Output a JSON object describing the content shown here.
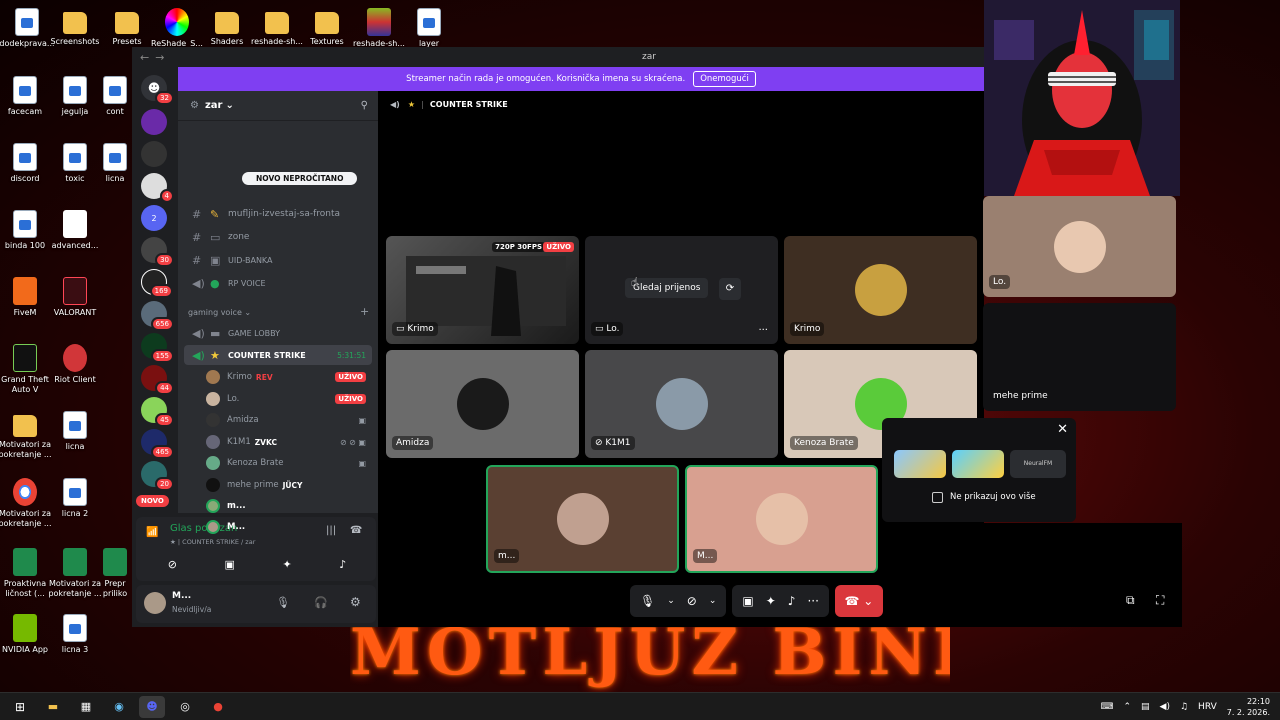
{
  "desktop": {
    "icons": [
      "dodekprava...",
      "Screenshots",
      "Presets",
      "ReShade_S...",
      "Shaders",
      "reshade-sh...",
      "Textures",
      "reshade-sh...",
      "layer",
      "facecam",
      "jegulja",
      "cont",
      "discord",
      "toxic",
      "licna",
      "binda 100",
      "advanced...",
      "FiveM",
      "VALORANT",
      "Grand Theft Auto V",
      "Riot Client",
      "Motivatori za pokretanje ...",
      "licna",
      "Motivatori za pokretanje ...",
      "licna 2",
      "Proaktivna ličnost (...",
      "Motivatori za pokretanje ...",
      "Prepr priliko",
      "NVIDIA App",
      "licna 3"
    ],
    "banner_text": "MOTLJUZ BINDA"
  },
  "taskbar": {
    "tray_language": "HRV",
    "time": "22:10",
    "date": "7. 2. 2026."
  },
  "window": {
    "title": "zar"
  },
  "notice": {
    "text": "Streamer način rada je omogućen. Korisnička imena su skraćena.",
    "button": "Onemogući"
  },
  "rail": {
    "badges": [
      "32",
      "4",
      "2",
      "30",
      "169",
      "656",
      "155",
      "44",
      "45",
      "465",
      "20"
    ],
    "novo": "NOVO"
  },
  "server": {
    "name": "zar"
  },
  "sidebar": {
    "new_unread": "NOVO NEPROČITANO",
    "channels": [
      "mufljin-izvestaj-sa-fronta",
      "zone",
      "UID-BANKA",
      "RP VOICE"
    ],
    "category": "gaming voice",
    "voice_channels": [
      "GAME LOBBY",
      "COUNTER STRIKE"
    ],
    "active_timer": "5:31:51",
    "live_label": "UŽIVO",
    "users": [
      {
        "name": "Krimo",
        "tag": "REV",
        "live": true
      },
      {
        "name": "Lo.",
        "tag": "",
        "live": true
      },
      {
        "name": "Amidza",
        "tag": "",
        "live": false
      },
      {
        "name": "K1M1",
        "tag": "ZVKC",
        "live": false
      },
      {
        "name": "Kenoza Brate",
        "tag": "",
        "live": false
      },
      {
        "name": "mehe prime",
        "tag": "JÜCY",
        "live": false
      },
      {
        "name": "m...",
        "tag": "",
        "live": false
      },
      {
        "name": "M...",
        "tag": "",
        "live": false
      }
    ]
  },
  "voice_panel": {
    "status": "Glas povezan",
    "location": "COUNTER STRIKE / zar"
  },
  "user_panel": {
    "name": "M...",
    "status": "Nevidljiv/a"
  },
  "stage": {
    "channel": "COUNTER STRIKE",
    "stream_quality": "720P 30FPS",
    "live_label": "UŽIVO",
    "watch_button": "Gledaj prijenos",
    "tiles": [
      "Krimo",
      "Lo.",
      "Krimo",
      "Lo.",
      "Amidza",
      "K1M1",
      "Kenoza Brate",
      "mehe prime",
      "m...",
      "M..."
    ],
    "promo_dismiss": "Ne prikazuj ovo više",
    "promo_brand": "NeuralFM"
  },
  "colors": {
    "accent": "#7f3ff2",
    "live": "#f23f43",
    "speaking": "#23a55a",
    "blurple": "#5865f2"
  }
}
